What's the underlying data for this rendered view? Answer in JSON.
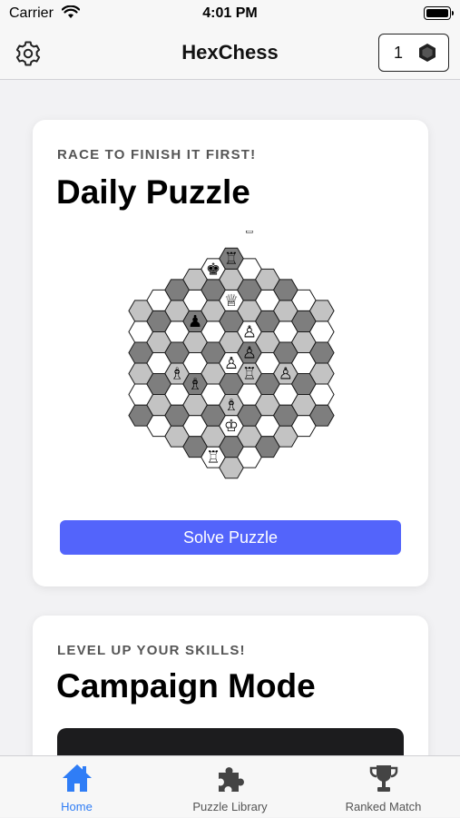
{
  "status_bar": {
    "carrier": "Carrier",
    "time": "4:01 PM"
  },
  "header": {
    "title": "HexChess",
    "gem_count": "1"
  },
  "daily_puzzle": {
    "eyebrow": "RACE TO FINISH IT FIRST!",
    "title": "Daily Puzzle",
    "button_label": "Solve Puzzle"
  },
  "campaign": {
    "eyebrow": "LEVEL UP YOUR SKILLS!",
    "title": "Campaign Mode"
  },
  "tabs": [
    {
      "label": "Home",
      "icon": "home-icon",
      "active": true
    },
    {
      "label": "Puzzle Library",
      "icon": "puzzle-icon",
      "active": false
    },
    {
      "label": "Ranked Match",
      "icon": "trophy-icon",
      "active": false
    }
  ],
  "colors": {
    "accent": "#5364fb",
    "tab_active": "#2f7df6",
    "hex_light": "#ffffff",
    "hex_mid": "#c3c3c3",
    "hex_dark": "#7e7e7e"
  },
  "pieces": [
    {
      "piece": "queen",
      "color": "white",
      "file": 1,
      "rank": 6
    },
    {
      "piece": "rook",
      "color": "white",
      "file": 0,
      "rank": 5
    },
    {
      "piece": "king",
      "color": "black",
      "file": -1,
      "rank": 5
    },
    {
      "piece": "pawn",
      "color": "black",
      "file": -2,
      "rank": 3
    },
    {
      "piece": "queen",
      "color": "white",
      "file": 0,
      "rank": 3
    },
    {
      "piece": "bishop",
      "color": "white",
      "file": -3,
      "rank": 1
    },
    {
      "piece": "bishop",
      "color": "white",
      "file": -2,
      "rank": 0
    },
    {
      "piece": "pawn",
      "color": "white",
      "file": 0,
      "rank": 0
    },
    {
      "piece": "pawn",
      "color": "white",
      "file": 1,
      "rank": 1
    },
    {
      "piece": "pawn",
      "color": "white",
      "file": 1,
      "rank": 0
    },
    {
      "piece": "rook",
      "color": "white",
      "file": 1,
      "rank": -1
    },
    {
      "piece": "pawn",
      "color": "white",
      "file": 3,
      "rank": -2
    },
    {
      "piece": "bishop",
      "color": "white",
      "file": 0,
      "rank": -2
    },
    {
      "piece": "king",
      "color": "white",
      "file": 0,
      "rank": -3
    },
    {
      "piece": "rook",
      "color": "white",
      "file": -1,
      "rank": -4
    }
  ]
}
